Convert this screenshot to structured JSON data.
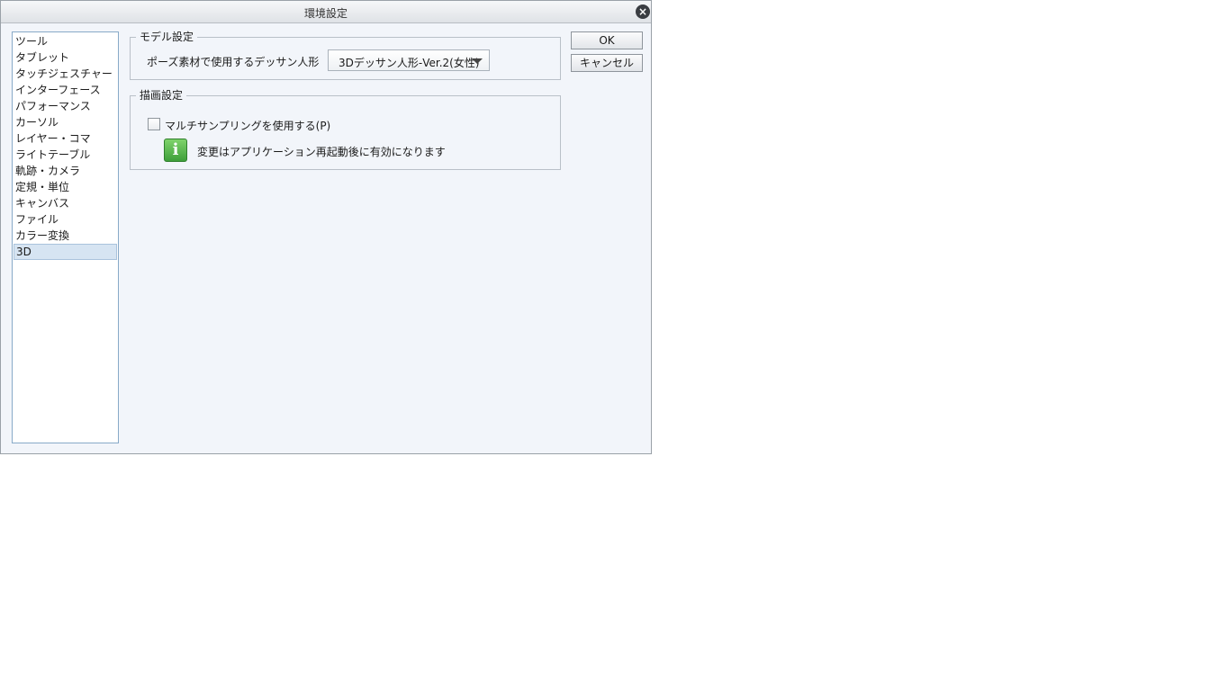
{
  "window": {
    "title": "環境設定",
    "close_glyph": "×"
  },
  "sidebar": {
    "items": [
      {
        "label": "ツール"
      },
      {
        "label": "タブレット"
      },
      {
        "label": "タッチジェスチャー"
      },
      {
        "label": "インターフェース"
      },
      {
        "label": "パフォーマンス"
      },
      {
        "label": "カーソル"
      },
      {
        "label": "レイヤー・コマ"
      },
      {
        "label": "ライトテーブル"
      },
      {
        "label": "軌跡・カメラ"
      },
      {
        "label": "定規・単位"
      },
      {
        "label": "キャンバス"
      },
      {
        "label": "ファイル"
      },
      {
        "label": "カラー変換"
      },
      {
        "label": "3D"
      }
    ],
    "selected": "3D"
  },
  "model_settings": {
    "legend": "モデル設定",
    "label": "ポーズ素材で使用するデッサン人形",
    "selected_value": "3Dデッサン人形-Ver.2(女性)"
  },
  "draw_settings": {
    "legend": "描画設定",
    "checkbox_label": "マルチサンプリングを使用する(P)",
    "checkbox_checked": false,
    "info_glyph": "i",
    "info_text": "変更はアプリケーション再起動後に有効になります"
  },
  "buttons": {
    "ok": "OK",
    "cancel": "キャンセル"
  },
  "colors": {
    "selection": "#d6e4f2",
    "info_icon": "#3e9f3a",
    "dialog_bg": "#f2f5fa"
  }
}
